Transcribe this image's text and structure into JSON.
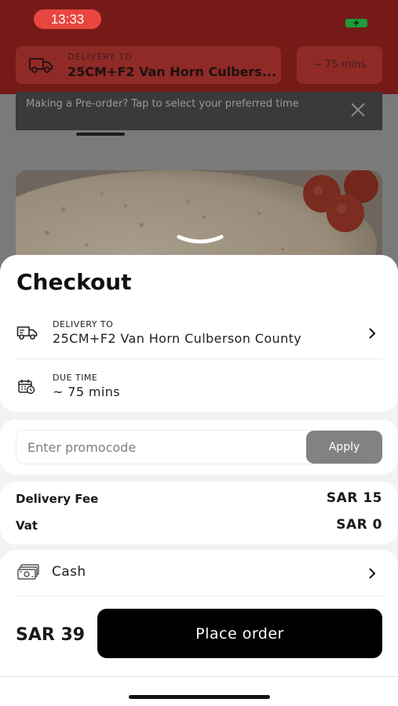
{
  "status_bar": {
    "time": "13:33"
  },
  "header": {
    "delivery_label": "DELIVERY TO",
    "delivery_address": "25CM+F2 Van Horn Culbers...",
    "eta": "~ 75 mins"
  },
  "preorder_banner": {
    "text": "Making a Pre-order? Tap to select your preferred time"
  },
  "checkout": {
    "title": "Checkout",
    "delivery_label": "DELIVERY TO",
    "delivery_address": "25CM+F2 Van Horn Culberson County",
    "due_label": "DUE TIME",
    "due_value": "~ 75 mins"
  },
  "promo": {
    "placeholder": "Enter promocode",
    "apply_label": "Apply"
  },
  "fees": {
    "delivery_fee_label": "Delivery Fee",
    "delivery_fee_value": "SAR 15",
    "vat_label": "Vat",
    "vat_value": "SAR 0"
  },
  "payment": {
    "method": "Cash"
  },
  "footer": {
    "total": "SAR 39",
    "place_order_label": "Place order"
  },
  "colors": {
    "header_red": "#761a18",
    "status_pill": "#e8463f",
    "apply_button": "#828282",
    "place_order_button": "#000000"
  },
  "icons": [
    "truck-icon",
    "calendar-clock-icon",
    "cash-icon",
    "chevron-right-icon",
    "close-icon",
    "chevron-down-icon",
    "battery-icon"
  ]
}
